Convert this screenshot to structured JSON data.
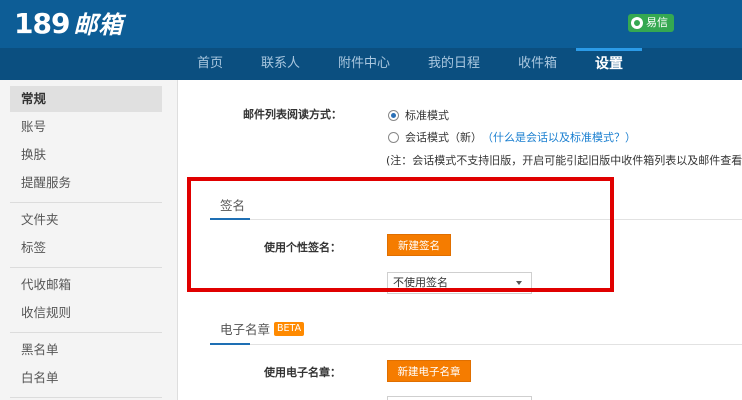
{
  "brand": {
    "logo_number": "189",
    "logo_text": "邮箱",
    "yixin_label": "易信"
  },
  "nav": {
    "items": [
      "首页",
      "联系人",
      "附件中心",
      "我的日程",
      "收件箱",
      "设置"
    ],
    "active": "设置"
  },
  "sidebar": {
    "groups": [
      [
        "常规",
        "账号",
        "换肤",
        "提醒服务"
      ],
      [
        "文件夹",
        "标签"
      ],
      [
        "代收邮箱",
        "收信规则"
      ],
      [
        "黑名单",
        "白名单"
      ]
    ],
    "active": "常规"
  },
  "mail_list": {
    "label": "邮件列表阅读方式：",
    "options": [
      "标准模式",
      "会话模式（新）"
    ],
    "selected": "标准模式",
    "help_link": "（什么是会话以及标准模式？）",
    "note": "(注：会话模式不支持旧版，开启可能引起旧版中收件箱列表以及邮件查看异常)"
  },
  "signature": {
    "title": "签名",
    "label": "使用个性签名：",
    "new_button": "新建签名",
    "select_value": "不使用签名"
  },
  "e_seal": {
    "title": "电子名章",
    "badge": "BETA",
    "label": "使用电子名章：",
    "new_button": "新建电子名章"
  },
  "colors": {
    "topbar": "#0d5d96",
    "navbar": "#0b4f80",
    "accent_orange": "#f57c00",
    "highlight_red": "#e00000"
  }
}
